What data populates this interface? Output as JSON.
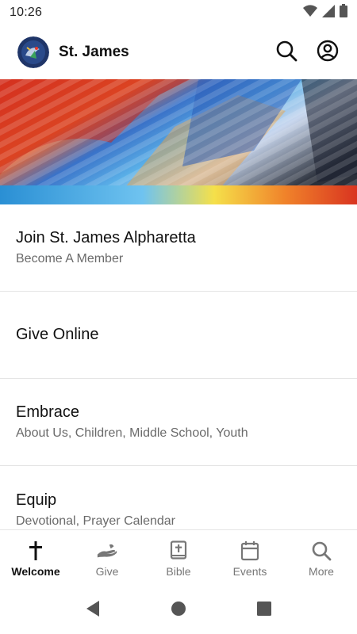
{
  "status_bar": {
    "time": "10:26",
    "icons": [
      "wifi-icon",
      "signal-icon",
      "battery-icon"
    ]
  },
  "header": {
    "title": "St. James",
    "actions": [
      "search-icon",
      "account-icon"
    ]
  },
  "colors": {
    "active": "#111111",
    "inactive": "#777777",
    "subtitle": "#6a6a6a",
    "divider": "#e4e4e4"
  },
  "menu": {
    "items": [
      {
        "title": "Join St. James Alpharetta",
        "subtitle": "Become A Member"
      },
      {
        "title": "Give Online",
        "subtitle": ""
      },
      {
        "title": "Embrace",
        "subtitle": "About Us, Children, Middle School, Youth"
      },
      {
        "title": "Equip",
        "subtitle": "Devotional, Prayer Calendar"
      }
    ]
  },
  "bottom_nav": {
    "items": [
      {
        "label": "Welcome",
        "icon": "cross-icon",
        "active": true
      },
      {
        "label": "Give",
        "icon": "give-hand-icon",
        "active": false
      },
      {
        "label": "Bible",
        "icon": "bible-icon",
        "active": false
      },
      {
        "label": "Events",
        "icon": "calendar-icon",
        "active": false
      },
      {
        "label": "More",
        "icon": "search-icon",
        "active": false
      }
    ]
  },
  "system_nav": [
    "back-icon",
    "home-icon",
    "recents-icon"
  ]
}
